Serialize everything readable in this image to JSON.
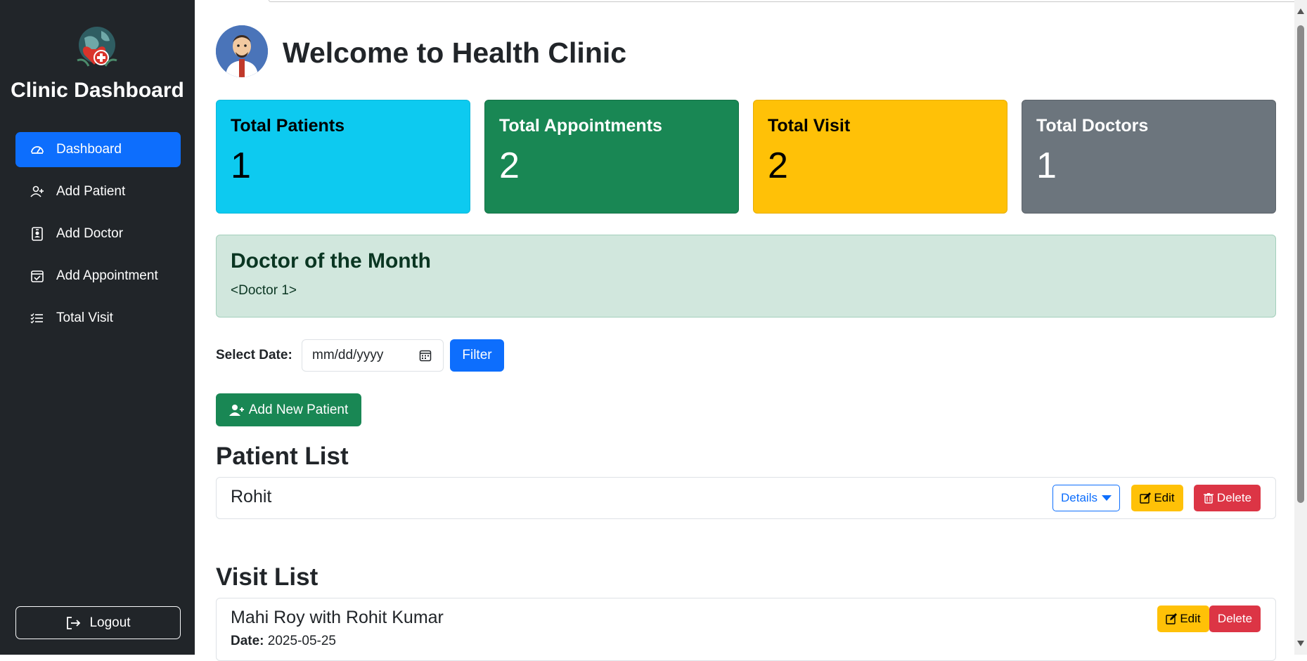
{
  "sidebar": {
    "brand": "Clinic Dashboard",
    "logo_icon": "heart-globe-icon",
    "items": [
      {
        "label": "Dashboard",
        "icon": "speedometer-icon",
        "active": true
      },
      {
        "label": "Add Patient",
        "icon": "person-plus-icon",
        "active": false
      },
      {
        "label": "Add Doctor",
        "icon": "person-badge-icon",
        "active": false
      },
      {
        "label": "Add Appointment",
        "icon": "calendar-check-icon",
        "active": false
      },
      {
        "label": "Total Visit",
        "icon": "list-check-icon",
        "active": false
      }
    ],
    "logout_label": "Logout"
  },
  "header": {
    "title": "Welcome to Health Clinic"
  },
  "stats": [
    {
      "label": "Total Patients",
      "value": "1",
      "color": "#0dcaf0"
    },
    {
      "label": "Total Appointments",
      "value": "2",
      "color": "#198754"
    },
    {
      "label": "Total Visit",
      "value": "2",
      "color": "#ffc107"
    },
    {
      "label": "Total Doctors",
      "value": "1",
      "color": "#6c757d"
    }
  ],
  "doctor_of_month": {
    "heading": "Doctor of the Month",
    "value": "<Doctor 1>"
  },
  "filter": {
    "label": "Select Date:",
    "placeholder": "mm/dd/yyyy",
    "button": "Filter"
  },
  "add_patient_button": "Add New Patient",
  "patient_list": {
    "title": "Patient List",
    "rows": [
      {
        "name": "Rohit",
        "details": "Details",
        "edit": "Edit",
        "delete": "Delete"
      }
    ]
  },
  "visit_list": {
    "title": "Visit List",
    "rows": [
      {
        "title": "Mahi Roy with Rohit Kumar",
        "date_label": "Date:",
        "date": "2025-05-25",
        "edit": "Edit",
        "delete": "Delete"
      }
    ]
  },
  "colors": {
    "sidebar_bg": "#212529",
    "primary": "#0d6efd",
    "success": "#198754",
    "warning": "#ffc107",
    "danger": "#dc3545"
  }
}
